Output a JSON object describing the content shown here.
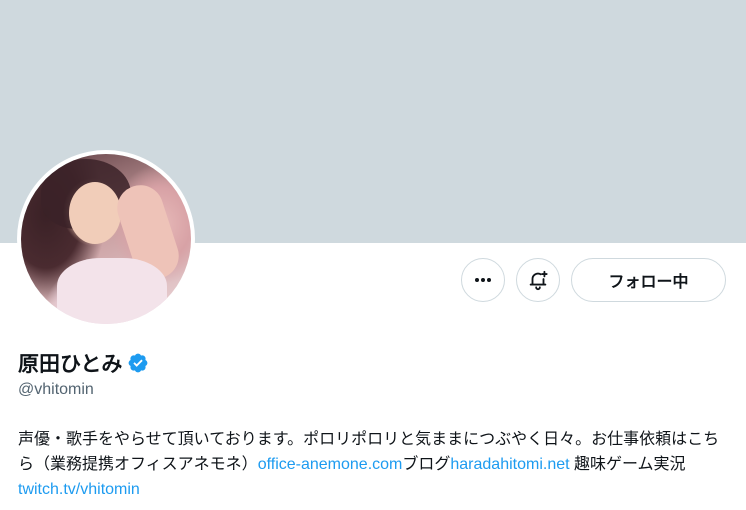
{
  "profile": {
    "display_name": "原田ひとみ",
    "handle": "@vhitomin",
    "verified": true,
    "verified_color": "#1d9bf0",
    "banner_color": "#cfd9de"
  },
  "actions": {
    "more_icon": "more-horizontal-icon",
    "notify_icon": "bell-plus-icon",
    "follow_label": "フォロー中"
  },
  "bio": {
    "part1": "声優・歌手をやらせて頂いております。ポロリポロリと気ままにつぶやく日々。お仕事依頼はこちら（業務提携オフィスアネモネ）",
    "link1": "office-anemone.com",
    "part2": "ブログ",
    "link2": "haradahitomi.net",
    "part3": " 趣味ゲーム実況",
    "link3": "twitch.tv/vhitomin"
  },
  "colors": {
    "link": "#1d9bf0",
    "text_primary": "#0f1419",
    "text_secondary": "#536471",
    "border": "#cfd9de"
  }
}
